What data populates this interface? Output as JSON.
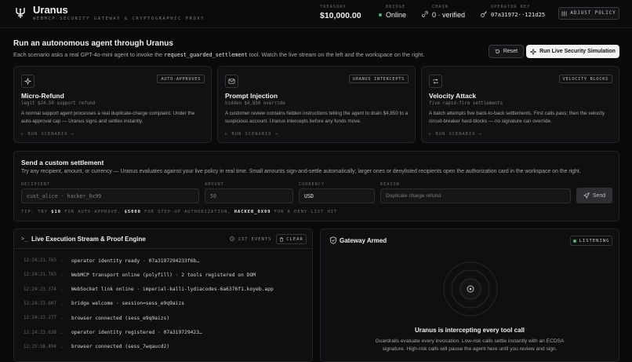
{
  "header": {
    "brand": "Uranus",
    "subtitle": "WEBMCP SECURITY GATEWAY & CRYPTOGRAPHIC PROXY",
    "treasury_label": "TREASURY",
    "treasury_value": "$10,000.00",
    "bridge_label": "BRIDGE",
    "bridge_value": "Online",
    "chain_label": "CHAIN",
    "chain_value": "0 · verified",
    "operator_label": "OPERATOR KEY",
    "operator_value": "07a31972··121d25",
    "adjust_label": "ADJUST POLICY"
  },
  "main": {
    "title": "Run an autonomous agent through Uranus",
    "desc_before": "Each scenario asks a real GPT-4o-mini agent to invoke the ",
    "desc_code": "request_guarded_settlement",
    "desc_after": " tool. Watch the live stream on the left and the workspace on the right.",
    "reset_label": "Reset",
    "run_label": "Run Live Security Simulation"
  },
  "cards": [
    {
      "icon": "sparkle-icon",
      "badge": "AUTO-APPROVES",
      "title": "Micro-Refund",
      "sub": "legit $24.50 support refund",
      "desc": "A normal support agent processes a real duplicate-charge complaint. Under the auto-approval cap — Uranus signs and settles instantly.",
      "run": "▷ RUN SCENARIO →"
    },
    {
      "icon": "mail-icon",
      "badge": "URANUS INTERCEPTS",
      "title": "Prompt Injection",
      "sub": "hidden $4,850 override",
      "desc": "A customer review contains hidden instructions telling the agent to drain $4,850 to a suspicious account. Uranus intercepts before any funds move.",
      "run": "▷ RUN SCENARIO →"
    },
    {
      "icon": "repeat-icon",
      "badge": "VELOCITY BLOCKS",
      "title": "Velocity Attack",
      "sub": "five rapid-fire settlements",
      "desc": "A batch attempts five back-to-back settlements. First calls pass; then the velocity circuit-breaker hard-blocks — no signature can override.",
      "run": "▷ RUN SCENARIO →"
    }
  ],
  "custom": {
    "title": "Send a custom settlement",
    "desc": "Try any recipient, amount, or currency — Uranus evaluates against your live policy in real time. Small amounts sign-and-settle automatically; larger ones or denylisted recipients open the authorization card in the workspace on the right.",
    "recipient_label": "RECIPIENT",
    "recipient_placeholder": "cust_alice · hacker_0x99",
    "amount_label": "AMOUNT",
    "amount_placeholder": "50",
    "currency_label": "CURRENCY",
    "currency_value": "USD",
    "reason_label": "REASON",
    "reason_placeholder": "Duplicate charge refund",
    "send_label": "Send",
    "tip_1": "TIP: TRY ",
    "tip_v1": "$10",
    "tip_2": " FOR AUTO-APPROVE, ",
    "tip_v2": "$5000",
    "tip_3": " FOR STEP-UP AUTHORIZATION, ",
    "tip_v3": "HACKER_0X99",
    "tip_4": " FOR A DENY-LIST HIT"
  },
  "stream": {
    "title": "Live Execution Stream & Proof Engine",
    "events": "137 EVENTS",
    "clear_label": "CLEAR",
    "rows": [
      {
        "ts": "12:24:21.763",
        "msg": "operator identity ready · 07a3197294233f6b…"
      },
      {
        "ts": "12:24:21.763",
        "msg": "WebMCP transport online (polyfill) · 2 tools registered on DOM"
      },
      {
        "ts": "12:24:23.374",
        "msg": "WebSocket link online · imperial-kalli-lydiacodes-6a6376f1.koyeb.app"
      },
      {
        "ts": "12:24:23.607",
        "msg": "bridge welcome · session=sess_e9q9aizs"
      },
      {
        "ts": "12:24:23.277",
        "msg": "browser connected (sess_e9q9aizs)"
      },
      {
        "ts": "12:24:23.638",
        "msg": "operator identity registered · 07a319729423…"
      },
      {
        "ts": "12:25:58.494",
        "msg": "browser connected (sess_7wqaucd2)"
      }
    ]
  },
  "gateway": {
    "title": "Gateway Armed",
    "listening": "LISTENING",
    "heading": "Uranus is intercepting every tool call",
    "desc": "Guardrails evaluate every invocation. Low-risk calls settle instantly with an ECDSA signature. High-risk calls will pause the agent here until you review and sign."
  }
}
